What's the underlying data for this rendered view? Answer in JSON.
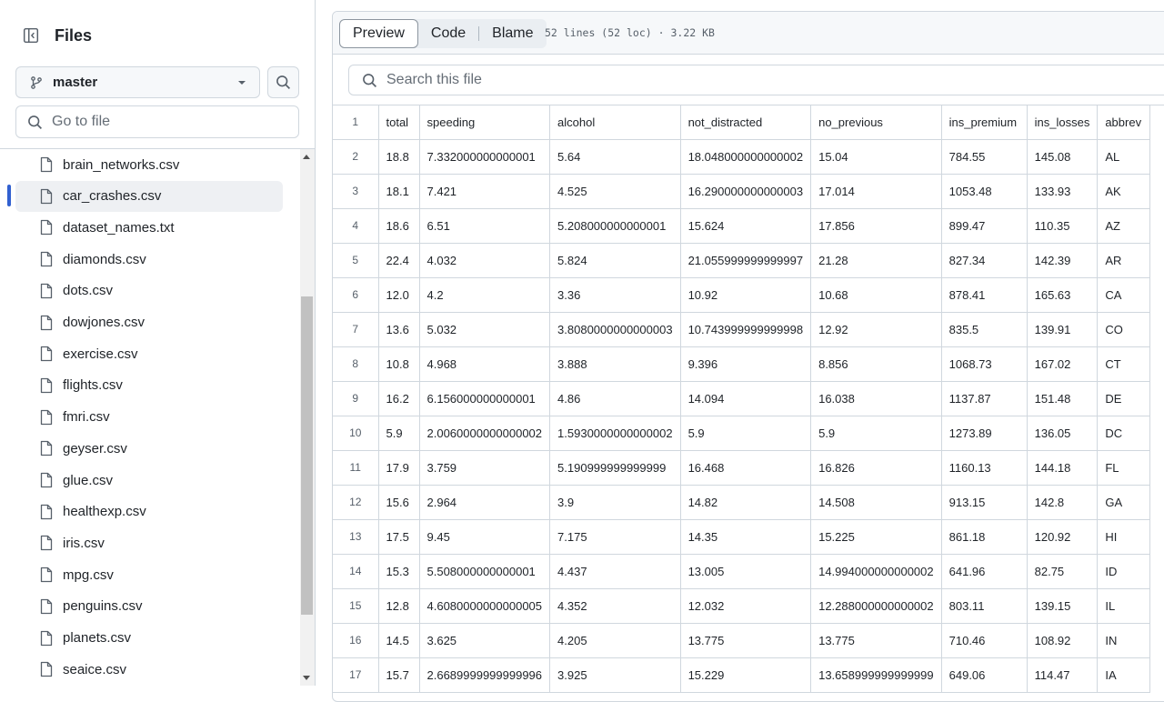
{
  "sidebar": {
    "title": "Files",
    "branch": "master",
    "goto_placeholder": "Go to file",
    "active_file": "car_crashes.csv",
    "files": [
      "brain_networks.csv",
      "car_crashes.csv",
      "dataset_names.txt",
      "diamonds.csv",
      "dots.csv",
      "dowjones.csv",
      "exercise.csv",
      "flights.csv",
      "fmri.csv",
      "geyser.csv",
      "glue.csv",
      "healthexp.csv",
      "iris.csv",
      "mpg.csv",
      "penguins.csv",
      "planets.csv",
      "seaice.csv"
    ]
  },
  "toolbar": {
    "tabs": [
      "Preview",
      "Code",
      "Blame"
    ],
    "active_tab": "Preview",
    "meta": "52 lines (52 loc) · 3.22 KB"
  },
  "search": {
    "placeholder": "Search this file"
  },
  "table": {
    "headers": [
      "total",
      "speeding",
      "alcohol",
      "not_distracted",
      "no_previous",
      "ins_premium",
      "ins_losses",
      "abbrev"
    ],
    "rows": [
      [
        "18.8",
        "7.332000000000001",
        "5.64",
        "18.048000000000002",
        "15.04",
        "784.55",
        "145.08",
        "AL"
      ],
      [
        "18.1",
        "7.421",
        "4.525",
        "16.290000000000003",
        "17.014",
        "1053.48",
        "133.93",
        "AK"
      ],
      [
        "18.6",
        "6.51",
        "5.208000000000001",
        "15.624",
        "17.856",
        "899.47",
        "110.35",
        "AZ"
      ],
      [
        "22.4",
        "4.032",
        "5.824",
        "21.055999999999997",
        "21.28",
        "827.34",
        "142.39",
        "AR"
      ],
      [
        "12.0",
        "4.2",
        "3.36",
        "10.92",
        "10.68",
        "878.41",
        "165.63",
        "CA"
      ],
      [
        "13.6",
        "5.032",
        "3.8080000000000003",
        "10.743999999999998",
        "12.92",
        "835.5",
        "139.91",
        "CO"
      ],
      [
        "10.8",
        "4.968",
        "3.888",
        "9.396",
        "8.856",
        "1068.73",
        "167.02",
        "CT"
      ],
      [
        "16.2",
        "6.156000000000001",
        "4.86",
        "14.094",
        "16.038",
        "1137.87",
        "151.48",
        "DE"
      ],
      [
        "5.9",
        "2.0060000000000002",
        "1.5930000000000002",
        "5.9",
        "5.9",
        "1273.89",
        "136.05",
        "DC"
      ],
      [
        "17.9",
        "3.759",
        "5.190999999999999",
        "16.468",
        "16.826",
        "1160.13",
        "144.18",
        "FL"
      ],
      [
        "15.6",
        "2.964",
        "3.9",
        "14.82",
        "14.508",
        "913.15",
        "142.8",
        "GA"
      ],
      [
        "17.5",
        "9.45",
        "7.175",
        "14.35",
        "15.225",
        "861.18",
        "120.92",
        "HI"
      ],
      [
        "15.3",
        "5.508000000000001",
        "4.437",
        "13.005",
        "14.994000000000002",
        "641.96",
        "82.75",
        "ID"
      ],
      [
        "12.8",
        "4.6080000000000005",
        "4.352",
        "12.032",
        "12.288000000000002",
        "803.11",
        "139.15",
        "IL"
      ],
      [
        "14.5",
        "3.625",
        "4.205",
        "13.775",
        "13.775",
        "710.46",
        "108.92",
        "IN"
      ],
      [
        "15.7",
        "2.6689999999999996",
        "3.925",
        "15.229",
        "13.658999999999999",
        "649.06",
        "114.47",
        "IA"
      ]
    ]
  },
  "colors": {
    "accent": "#3160d0",
    "border": "#d0d7de",
    "muted": "#57606a"
  }
}
